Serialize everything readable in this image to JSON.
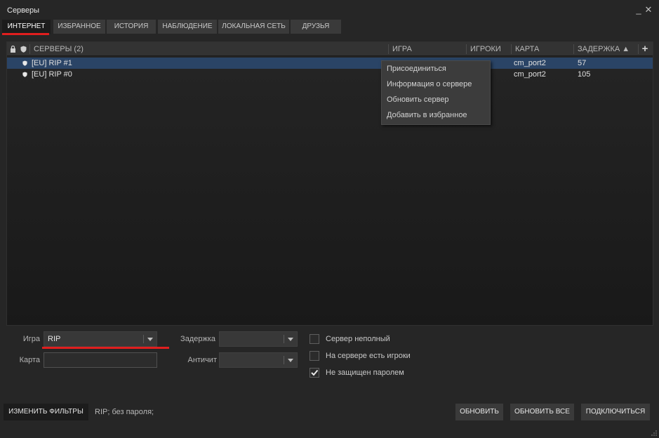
{
  "window": {
    "title": "Серверы",
    "minimize_label": "_",
    "close_label": "✕"
  },
  "tabs": [
    {
      "label": "ИНТЕРНЕТ",
      "active": true
    },
    {
      "label": "ИЗБРАННОЕ",
      "active": false
    },
    {
      "label": "ИСТОРИЯ",
      "active": false
    },
    {
      "label": "НАБЛЮДЕНИЕ",
      "active": false
    },
    {
      "label": "ЛОКАЛЬНАЯ СЕТЬ",
      "active": false
    },
    {
      "label": "ДРУЗЬЯ",
      "active": false
    }
  ],
  "server_list": {
    "columns": {
      "lock_icon": "lock-icon",
      "secure_icon": "shield-icon",
      "servers": "СЕРВЕРЫ (2)",
      "game": "ИГРА",
      "players": "ИГРОКИ",
      "map": "КАРТА",
      "latency": "ЗАДЕРЖКА ▲",
      "add_column": "+"
    },
    "rows": [
      {
        "name": "[EU] RIP #1",
        "game": "",
        "players": "",
        "map": "cm_port2",
        "latency": "57",
        "selected": true,
        "secure": true
      },
      {
        "name": "[EU] RIP #0",
        "game": "",
        "players": "",
        "map": "cm_port2",
        "latency": "105",
        "selected": false,
        "secure": true
      }
    ]
  },
  "context_menu": {
    "items": [
      "Присоединиться",
      "Информация о сервере",
      "Обновить сервер",
      "Добавить в избранное"
    ]
  },
  "filters": {
    "game_label": "Игра",
    "game_value": "RIP",
    "map_label": "Карта",
    "map_value": "",
    "latency_label": "Задержка",
    "latency_value": "",
    "anticheat_label": "Античит",
    "anticheat_value": "",
    "checkboxes": [
      {
        "label": "Сервер неполный",
        "checked": false
      },
      {
        "label": "На сервере есть игроки",
        "checked": false
      },
      {
        "label": "Не защищен паролем",
        "checked": true
      }
    ]
  },
  "footer": {
    "edit_filters": "ИЗМЕНИТЬ ФИЛЬТРЫ",
    "status": "RIP; без пароля;",
    "refresh": "ОБНОВИТЬ",
    "refresh_all": "ОБНОВИТЬ ВСЕ",
    "connect": "ПОДКЛЮЧИТЬСЯ"
  },
  "colors": {
    "accent_red": "#e01e1e",
    "selection_blue": "#2a4466",
    "background": "#262626"
  }
}
